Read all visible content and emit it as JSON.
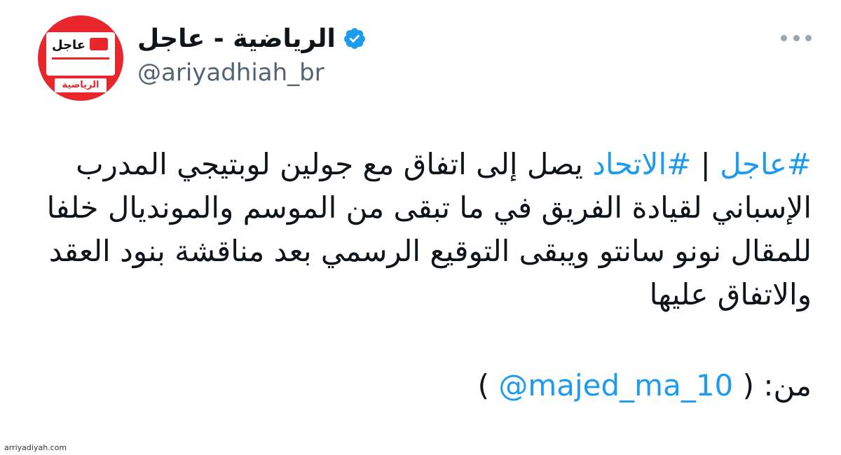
{
  "account": {
    "display_name": "الرياضية - عاجل",
    "handle": "@ariyadhiah_br",
    "verified": true,
    "avatar": {
      "top_text": "عاجل",
      "bottom_text": "الرياضية",
      "color": "#e8262c"
    }
  },
  "tweet": {
    "hashtag_1": "#عاجل",
    "separator": " | ",
    "hashtag_2": "#الاتحاد",
    "body": " يصل إلى اتفاق مع جولين لوبتيجي المدرب الإسباني لقيادة الفريق في ما تبقى من الموسم والمونديال خلفا للمقال نونو سانتو ويبقى التوقيع الرسمي بعد مناقشة بنود العقد والاتفاق عليها",
    "source_prefix": "من: (",
    "source_mention": "@majed_ma_10",
    "source_suffix": ")"
  },
  "icons": {
    "verified": "verified-badge-icon",
    "more": "more-options-icon"
  },
  "colors": {
    "link": "#1d9bf0",
    "text": "#0f1419",
    "secondary": "#536471"
  },
  "watermark": "arriyadiyah.com"
}
